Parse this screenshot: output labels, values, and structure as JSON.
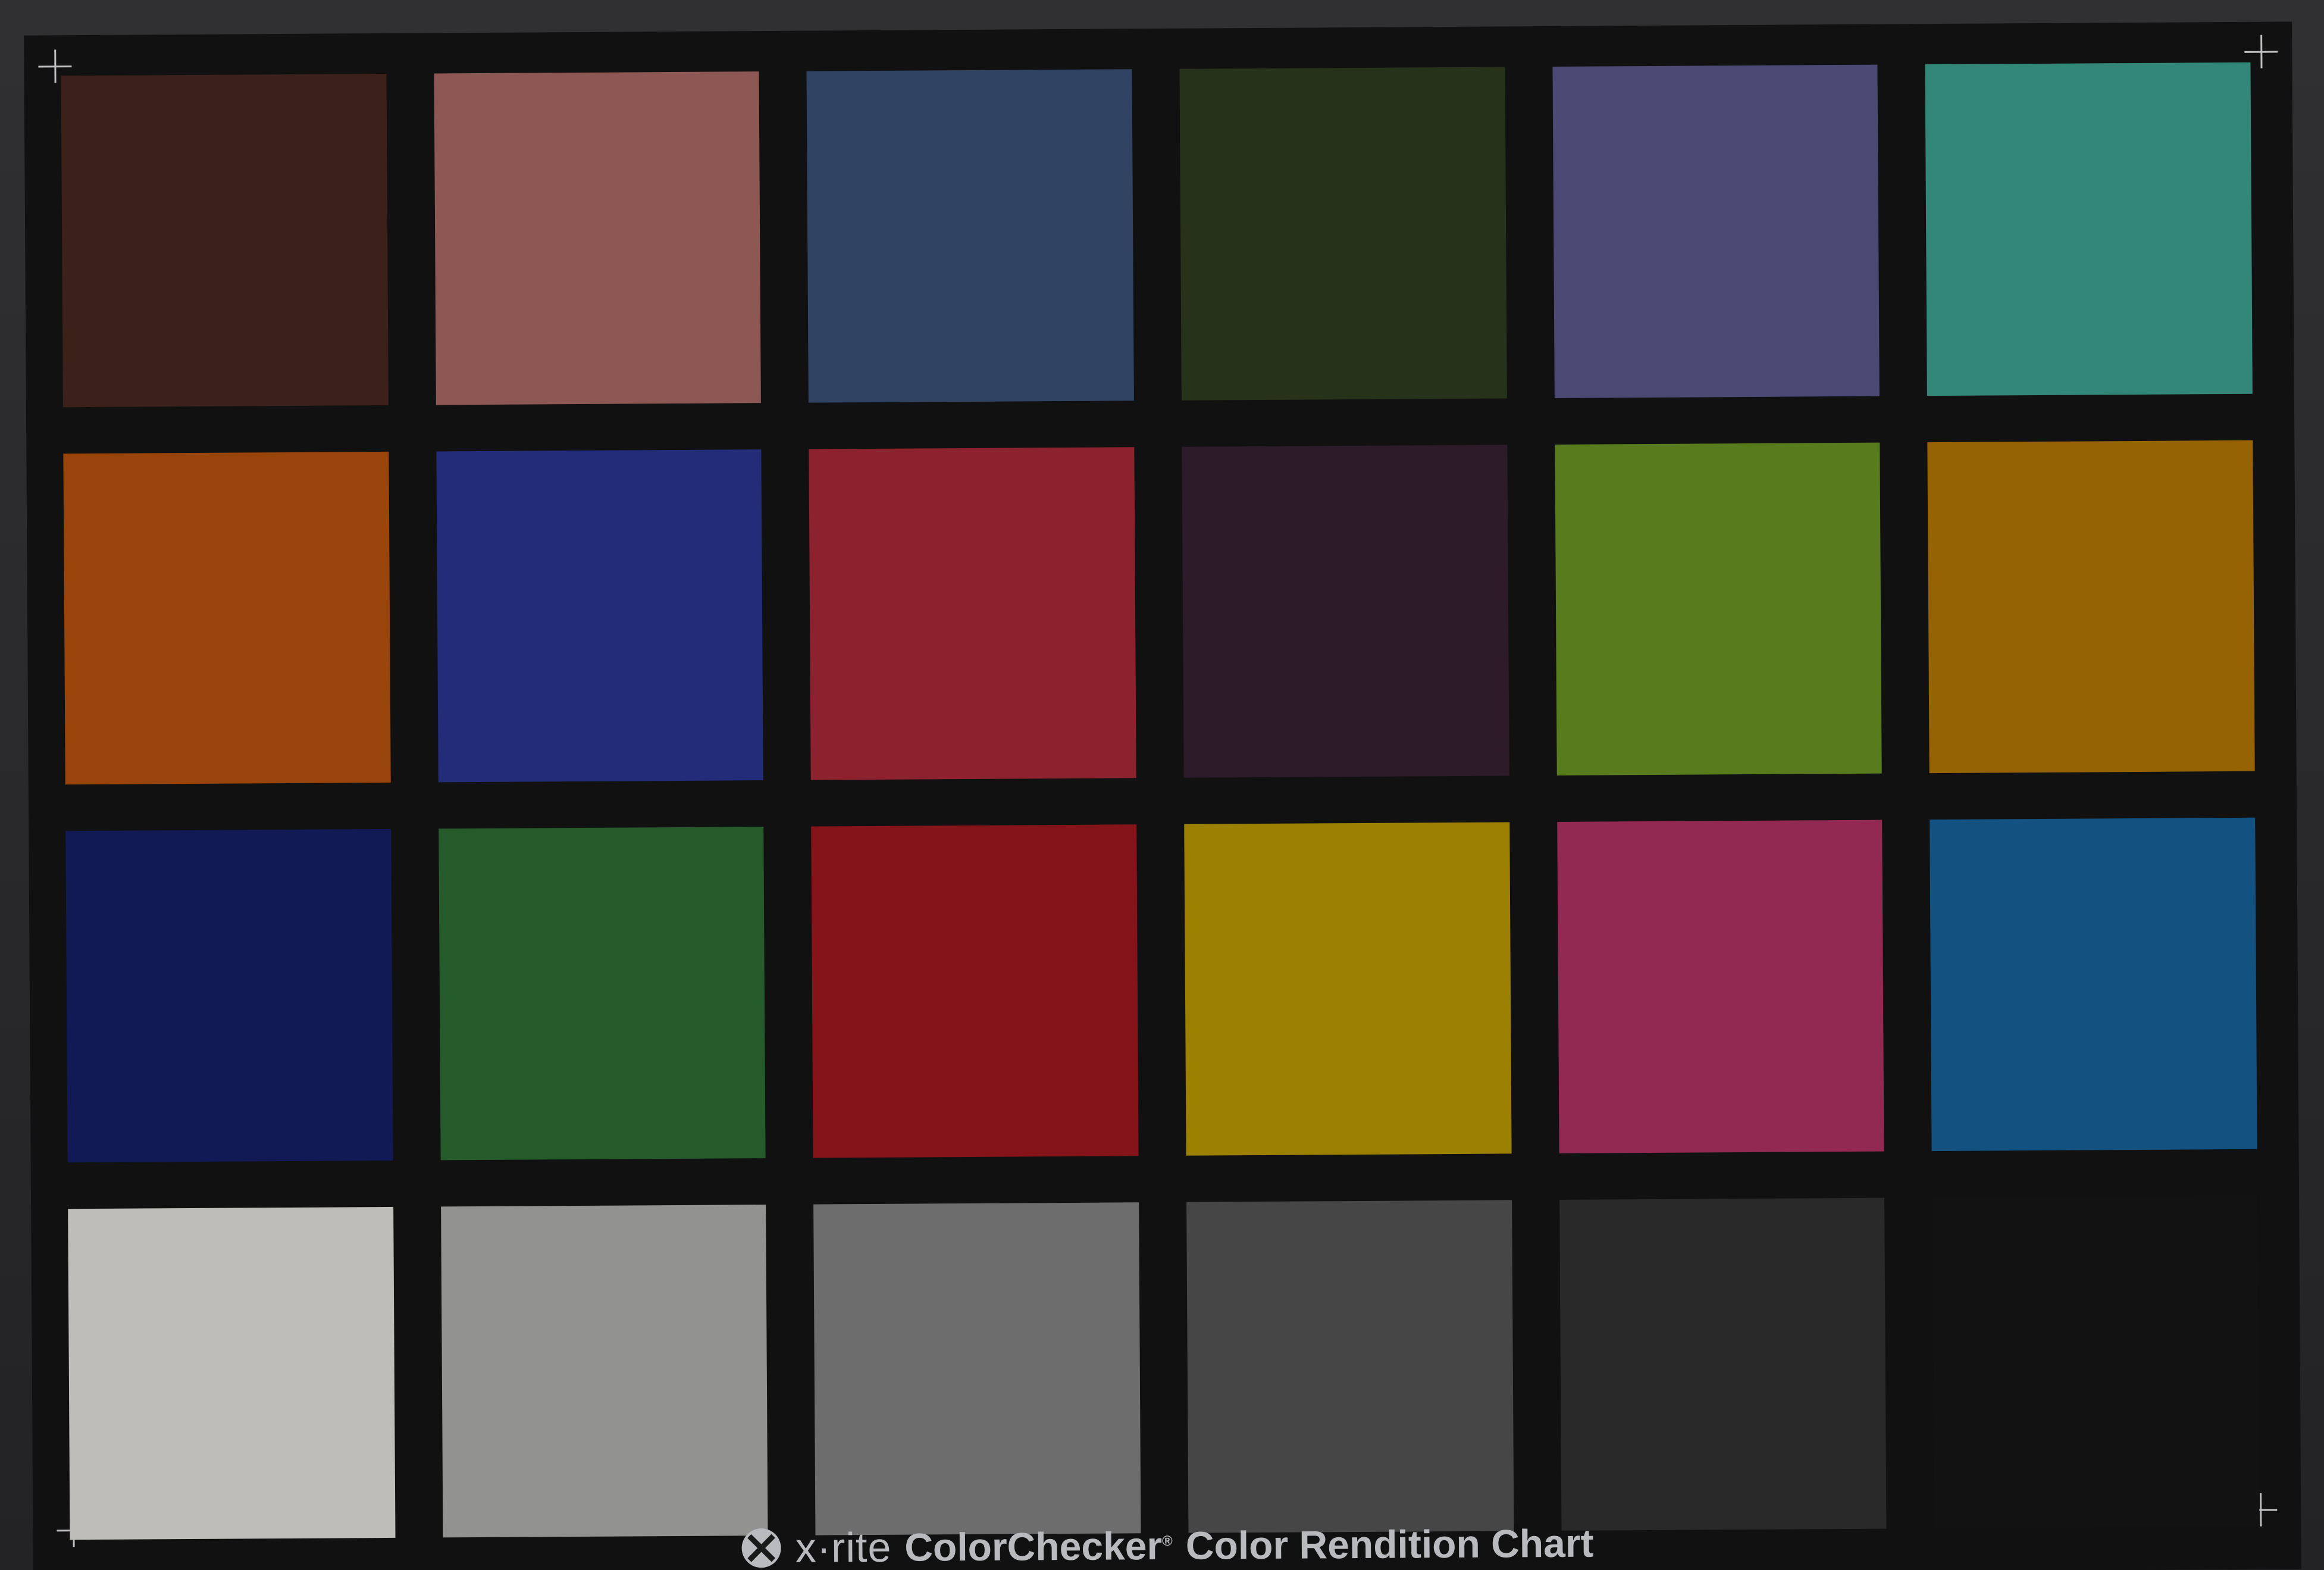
{
  "chart": {
    "brand": "x·rite",
    "product": "ColorChecker",
    "registered": "®",
    "subtitle": "Color Rendition Chart",
    "patches": [
      {
        "color": "#3b2119"
      },
      {
        "color": "#8d5853"
      },
      {
        "color": "#314363"
      },
      {
        "color": "#27321a"
      },
      {
        "color": "#4b4874"
      },
      {
        "color": "#338779"
      },
      {
        "color": "#98440a"
      },
      {
        "color": "#222c78"
      },
      {
        "color": "#8b222d"
      },
      {
        "color": "#2e1b2a"
      },
      {
        "color": "#587c1d"
      },
      {
        "color": "#956204"
      },
      {
        "color": "#121a56"
      },
      {
        "color": "#255a2b"
      },
      {
        "color": "#85131a"
      },
      {
        "color": "#9b8002"
      },
      {
        "color": "#912953"
      },
      {
        "color": "#135181"
      },
      {
        "color": "#bfbdb9"
      },
      {
        "color": "#929291"
      },
      {
        "color": "#6d6d6d"
      },
      {
        "color": "#464646"
      },
      {
        "color": "#292929"
      },
      {
        "color": "#121212"
      }
    ]
  }
}
